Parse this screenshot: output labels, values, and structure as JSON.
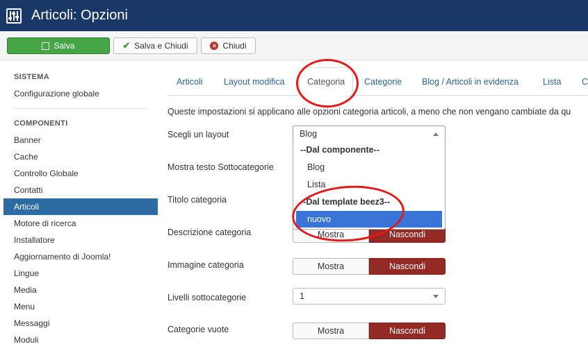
{
  "window": {
    "title": "Articoli: Opzioni",
    "icon": "options-sliders-icon"
  },
  "toolbar": {
    "save_label": "Salva",
    "save_close_label": "Salva e Chiudi",
    "close_label": "Chiudi"
  },
  "sidebar": {
    "section_system": "SISTEMA",
    "global_config": "Configurazione globale",
    "section_components": "COMPONENTI",
    "items": [
      "Banner",
      "Cache",
      "Controllo Globale",
      "Contatti",
      "Articoli",
      "Motore di ricerca",
      "Installatore",
      "Aggiornamento di Joomla!",
      "Lingue",
      "Media",
      "Menu",
      "Messaggi",
      "Moduli"
    ],
    "active_item": "Articoli"
  },
  "tabs": [
    "Articoli",
    "Layout modifica",
    "Categoria",
    "Categorie",
    "Blog / Articoli in evidenza",
    "Lista",
    "C"
  ],
  "active_tab": "Categoria",
  "description": "Queste impostazioni si applicano alle opzioni categoria articoli, a meno che non vengano cambiate da qu",
  "fields": {
    "layout": {
      "label": "Scegli un layout",
      "value": "Blog"
    },
    "subcat_text": {
      "label": "Mostra testo Sottocategorie"
    },
    "cat_title": {
      "label": "Titolo categoria"
    },
    "cat_desc": {
      "label": "Descrizione categoria",
      "show": "Mostra",
      "hide": "Nascondi"
    },
    "cat_image": {
      "label": "Immagine categoria",
      "show": "Mostra",
      "hide": "Nascondi"
    },
    "subcat_levels": {
      "label": "Livelli sottocategorie",
      "value": "1"
    },
    "empty_cats": {
      "label": "Categorie vuote",
      "show": "Mostra",
      "hide": "Nascondi"
    }
  },
  "dropdown": {
    "group_component": "--Dal componente--",
    "opt_blog": "Blog",
    "opt_list": "Lista",
    "group_template": "--Dal template beez3--",
    "opt_new": "nuovo"
  },
  "colors": {
    "titlebar": "#1a3867",
    "save_button": "#46a546",
    "active_sidebar": "#2d6ca2",
    "hide_button": "#942a25",
    "highlight_option": "#3875d7",
    "annotation_ring": "#e41a1a"
  }
}
